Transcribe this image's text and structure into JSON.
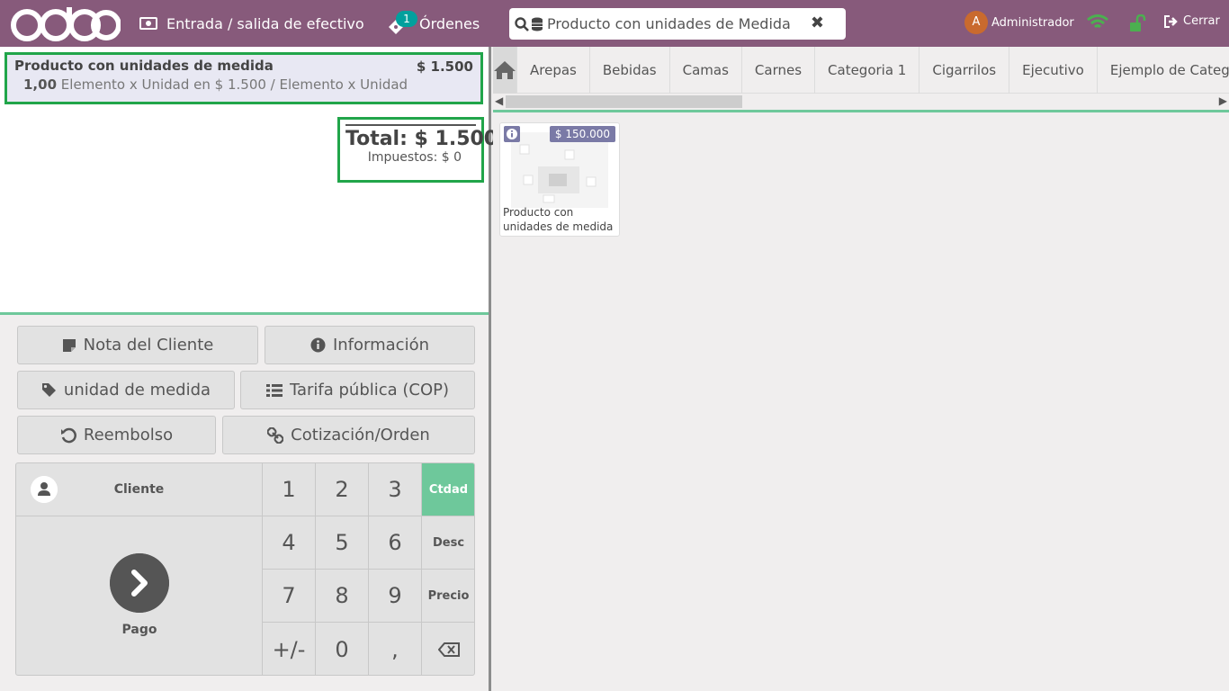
{
  "topbar": {
    "brand": "odoo",
    "cash_label": "Entrada / salida de efectivo",
    "orders_label": "Órdenes",
    "orders_count": "1",
    "search_value": "Producto con unidades de Medida",
    "user_initial": "A",
    "user_name": "Administrador",
    "close_label": "Cerrar"
  },
  "order": {
    "line": {
      "name": "Producto con unidades de medida",
      "price": "$ 1.500",
      "qty": "1,00",
      "detail": "Elemento x Unidad en $ 1.500 / Elemento x Unidad"
    },
    "total": "Total: $ 1.500",
    "taxes": "Impuestos: $ 0"
  },
  "controls": {
    "note": "Nota del Cliente",
    "info": "Información",
    "uom": "unidad de medida",
    "pricelist": "Tarifa pública (COP)",
    "refund": "Reembolso",
    "quotation": "Cotización/Orden"
  },
  "pad": {
    "customer": "Cliente",
    "payment": "Pago",
    "keys": [
      "1",
      "2",
      "3",
      "4",
      "5",
      "6",
      "7",
      "8",
      "9",
      "+/-",
      "0",
      ","
    ],
    "modes": [
      "Ctdad",
      "Desc",
      "Precio"
    ]
  },
  "categories": [
    "Arepas",
    "Bebidas",
    "Camas",
    "Carnes",
    "Categoria 1",
    "Cigarrilos",
    "Ejecutivo",
    "Ejemplo de Categoria"
  ],
  "product": {
    "price": "$ 150.000",
    "name": "Producto con unidades de medida"
  },
  "colors": {
    "topbar": "#875a7b",
    "accent_green": "#6ec89b",
    "highlight_border": "#21a54a",
    "badge": "#00a09d",
    "price_tag": "#7a7aa6"
  },
  "icons": [
    "money-icon",
    "ticket-icon",
    "search-icon",
    "database-icon",
    "close-x-icon",
    "wifi-icon",
    "unlock-icon",
    "sign-out-icon",
    "sticky-note-icon",
    "info-icon",
    "tag-icon",
    "list-icon",
    "undo-icon",
    "link-icon",
    "user-icon",
    "chevron-right-icon",
    "backspace-icon",
    "home-icon"
  ]
}
